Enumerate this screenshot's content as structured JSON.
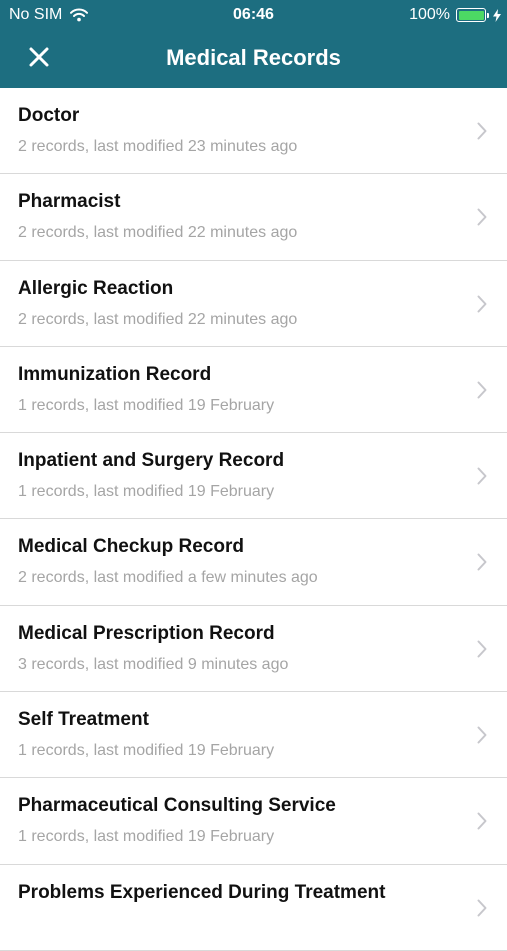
{
  "status_bar": {
    "carrier": "No SIM",
    "time": "06:46",
    "battery": "100%"
  },
  "nav": {
    "title": "Medical Records",
    "close_icon": "close-icon"
  },
  "colors": {
    "header": "#1d6e80",
    "battery_fill": "#4cd964",
    "subtitle": "#a5a5a5"
  },
  "records": [
    {
      "title": "Doctor",
      "subtitle": "2 records, last modified 23 minutes ago"
    },
    {
      "title": "Pharmacist",
      "subtitle": "2 records, last modified 22 minutes ago"
    },
    {
      "title": "Allergic Reaction",
      "subtitle": "2 records, last modified 22 minutes ago"
    },
    {
      "title": "Immunization Record",
      "subtitle": "1 records, last modified 19 February"
    },
    {
      "title": "Inpatient and Surgery Record",
      "subtitle": "1 records, last modified 19 February"
    },
    {
      "title": "Medical Checkup Record",
      "subtitle": "2 records, last modified a few minutes ago"
    },
    {
      "title": "Medical Prescription Record",
      "subtitle": "3 records, last modified 9 minutes ago"
    },
    {
      "title": "Self Treatment",
      "subtitle": "1 records, last modified 19 February"
    },
    {
      "title": "Pharmaceutical Consulting Service",
      "subtitle": "1 records, last modified 19 February"
    },
    {
      "title": "Problems Experienced During Treatment",
      "subtitle": ""
    }
  ]
}
